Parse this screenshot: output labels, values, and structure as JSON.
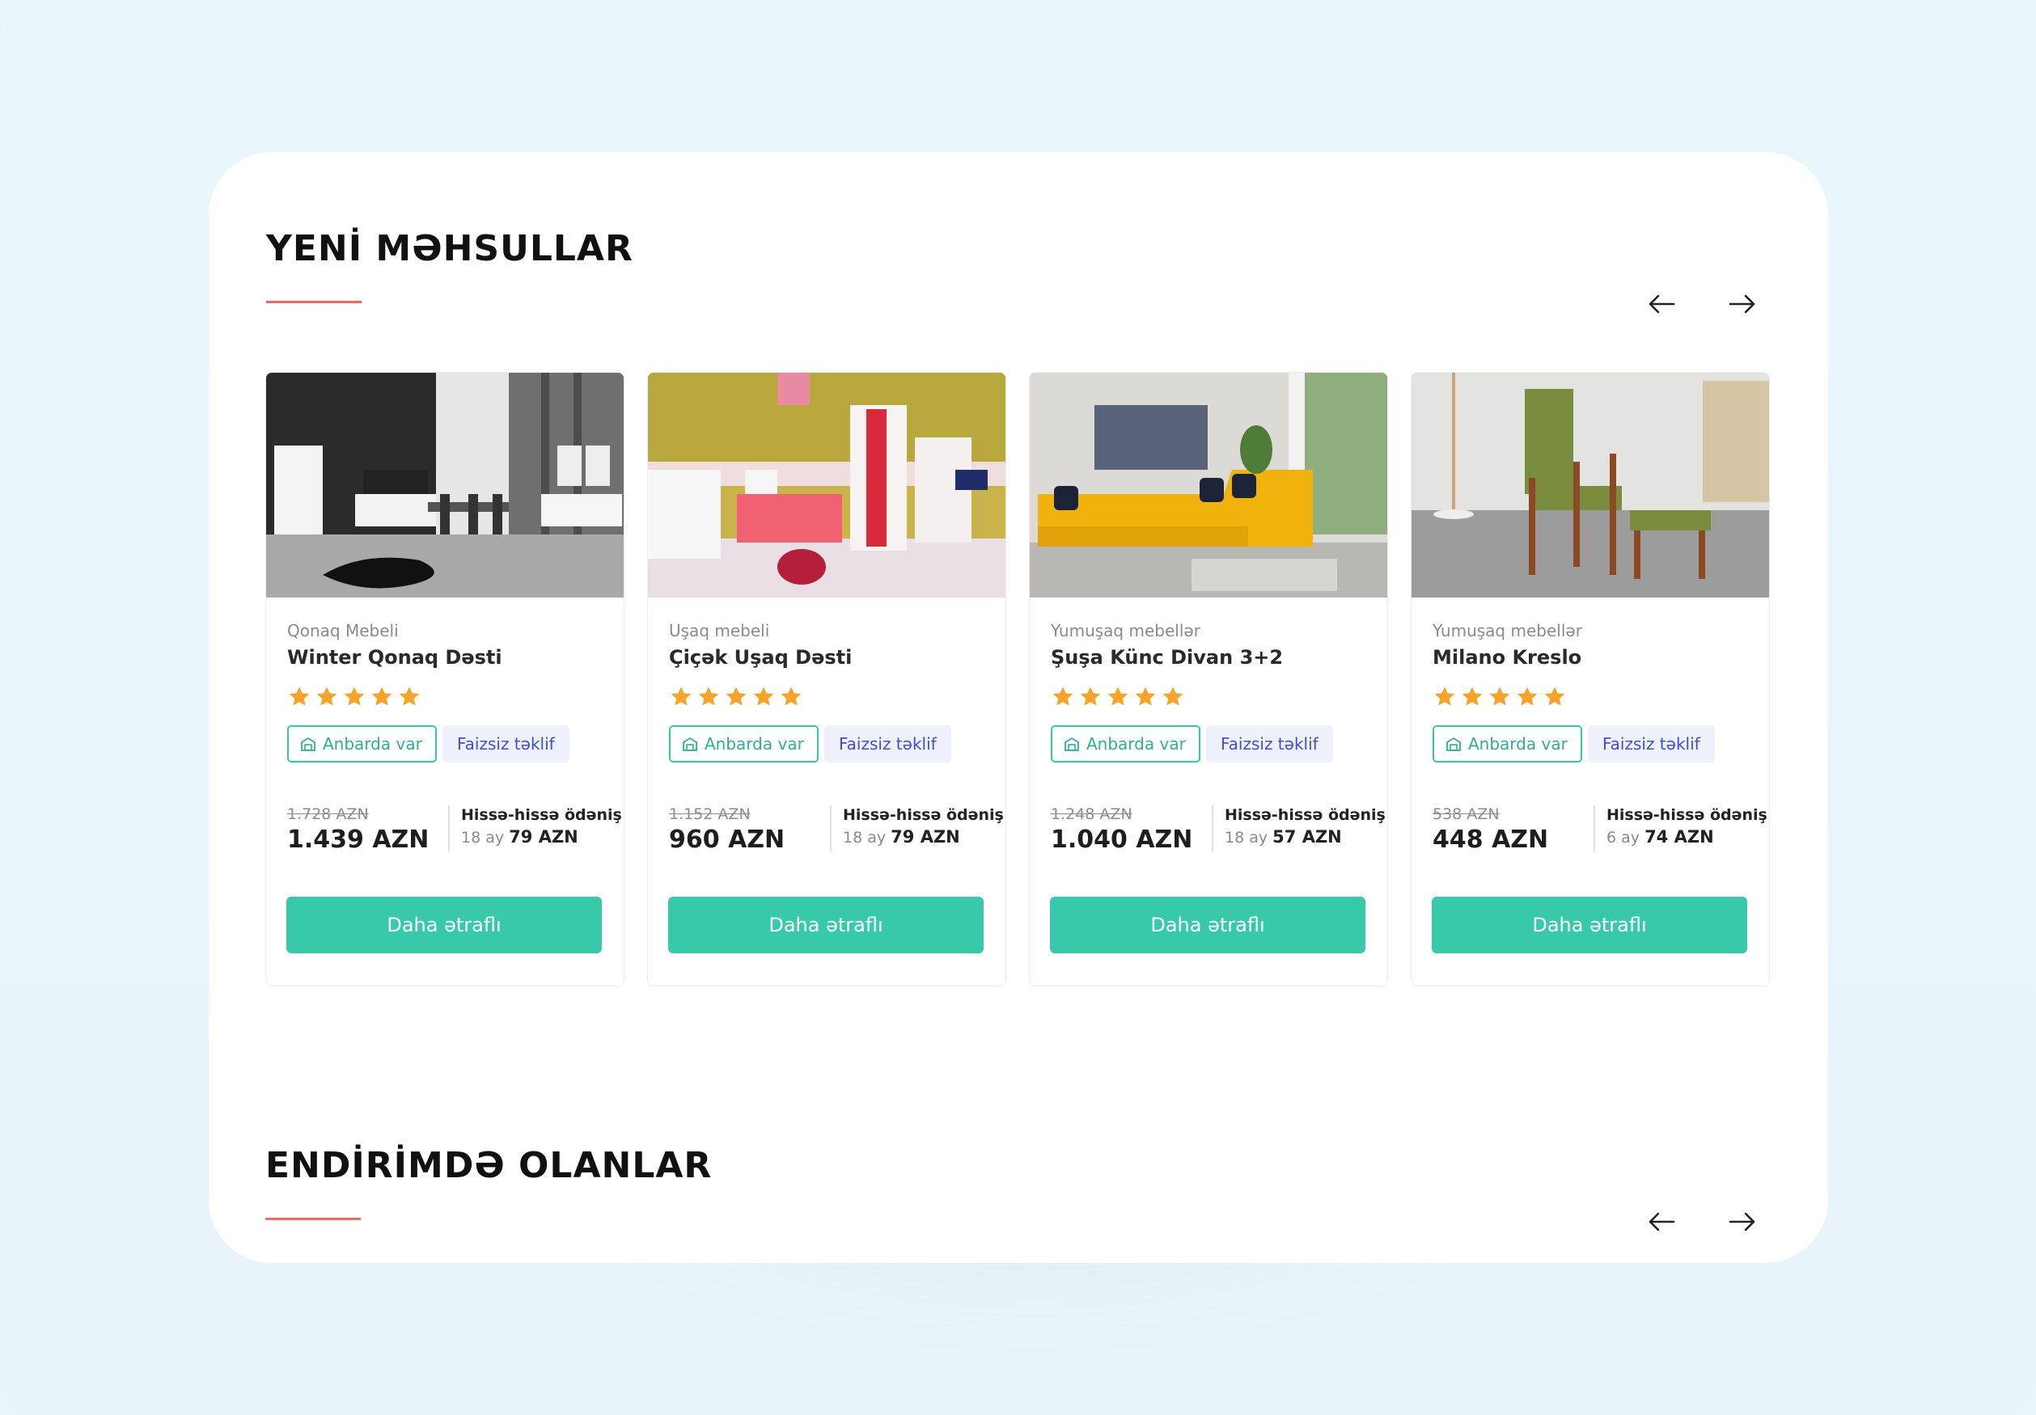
{
  "sections": [
    {
      "title": "YENİ MƏHSULLAR"
    },
    {
      "title": "ENDİRİMDƏ OLANLAR"
    }
  ],
  "colors": {
    "accent": "#37c9aa",
    "underline": "#ef6a66",
    "star": "#f7a22b",
    "offer_text": "#4150c8"
  },
  "nav": {
    "prev_icon": "arrow-left-icon",
    "next_icon": "arrow-right-icon"
  },
  "products": [
    {
      "category": "Qonaq Mebeli",
      "name": "Winter Qonaq Dəsti",
      "rating": 5,
      "stock_label": "Anbarda var",
      "offer_label": "Faizsiz təklif",
      "old_price": "1.728 AZN",
      "price": "1.439 AZN",
      "installment_label": "Hissə-hissə ödəniş",
      "installment_months": "18 ay",
      "installment_amount": "79 AZN",
      "button_label": "Daha ətraflı"
    },
    {
      "category": "Uşaq mebeli",
      "name": "Çiçək Uşaq Dəsti",
      "rating": 5,
      "stock_label": "Anbarda var",
      "offer_label": "Faizsiz təklif",
      "old_price": "1.152 AZN",
      "price": "960 AZN",
      "installment_label": "Hissə-hissə ödəniş",
      "installment_months": "18 ay",
      "installment_amount": "79 AZN",
      "button_label": "Daha ətraflı"
    },
    {
      "category": "Yumuşaq mebellər",
      "name": "Şuşa Künc Divan 3+2",
      "rating": 5,
      "stock_label": "Anbarda var",
      "offer_label": "Faizsiz təklif",
      "old_price": "1.248 AZN",
      "price": "1.040 AZN",
      "installment_label": "Hissə-hissə ödəniş",
      "installment_months": "18 ay",
      "installment_amount": "57 AZN",
      "button_label": "Daha ətraflı"
    },
    {
      "category": "Yumuşaq mebellər",
      "name": "Milano Kreslo",
      "rating": 5,
      "stock_label": "Anbarda var",
      "offer_label": "Faizsiz təklif",
      "old_price": "538 AZN",
      "price": "448 AZN",
      "installment_label": "Hissə-hissə ödəniş",
      "installment_months": "6 ay",
      "installment_amount": "74 AZN",
      "button_label": "Daha ətraflı"
    }
  ]
}
